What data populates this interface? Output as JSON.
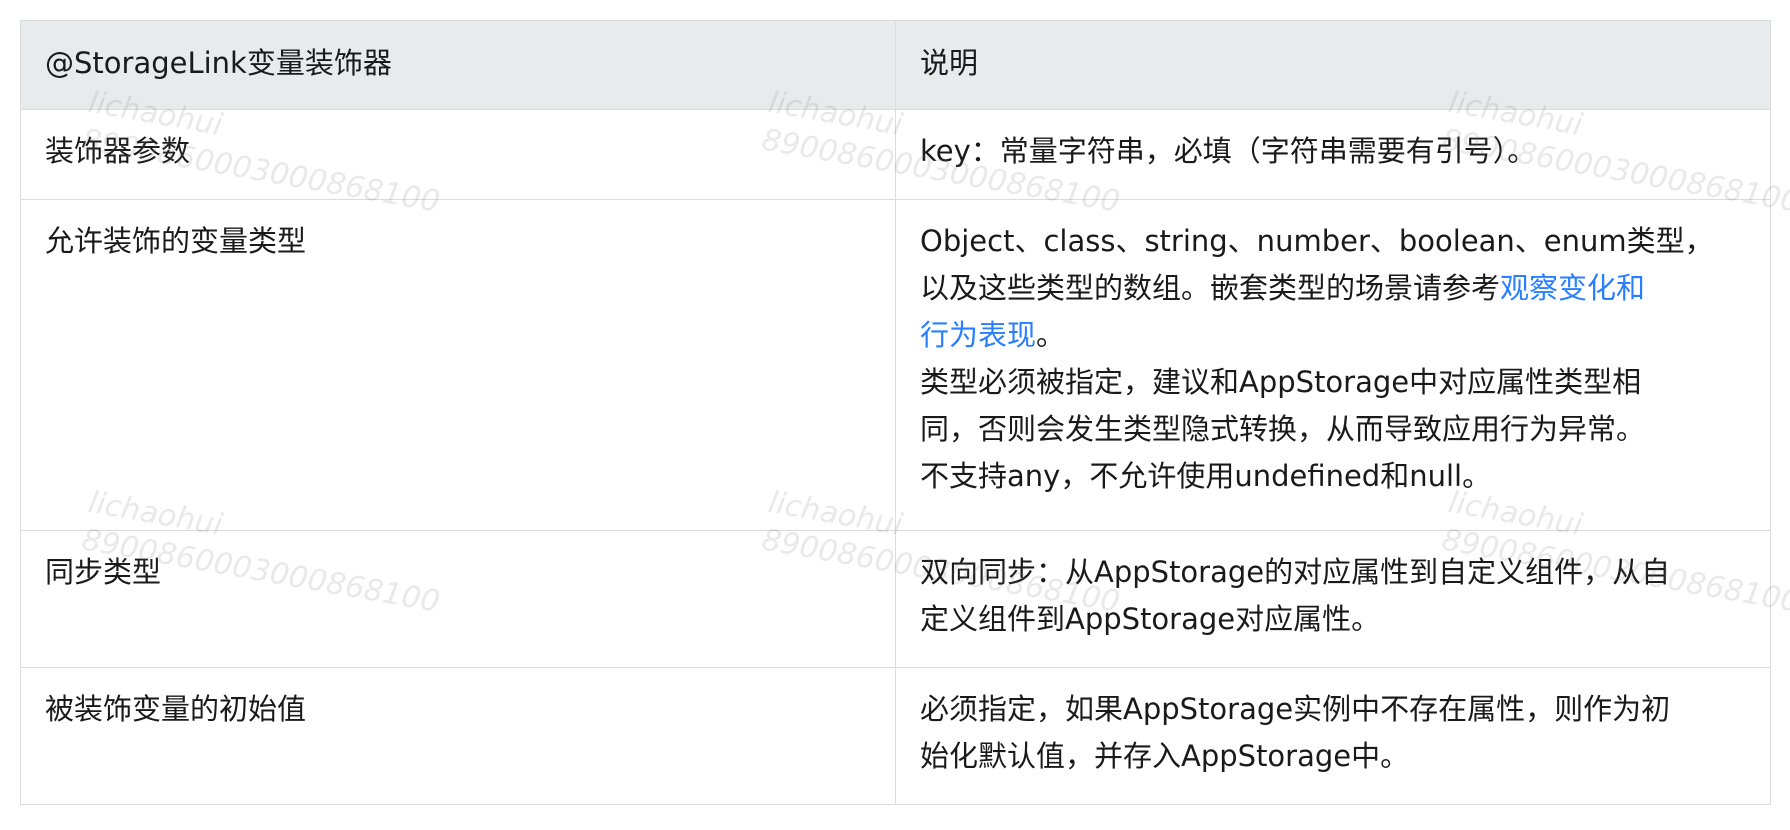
{
  "table": {
    "headers": [
      "@StorageLink变量装饰器",
      "说明"
    ],
    "rows": [
      {
        "label": "装饰器参数",
        "desc": "key：常量字符串，必填（字符串需要有引号）。"
      },
      {
        "label": "允许装饰的变量类型",
        "desc_line1": "Object、class、string、number、boolean、enum类型，",
        "desc_line2_prefix": "以及这些类型的数组。嵌套类型的场景请参考",
        "desc_link_part1": "观察变化和",
        "desc_link_part2": "行为表现",
        "desc_link_suffix": "。",
        "desc_line4": "类型必须被指定，建议和AppStorage中对应属性类型相",
        "desc_line5": "同，否则会发生类型隐式转换，从而导致应用行为异常。",
        "desc_line6": "不支持any，不允许使用undefined和null。"
      },
      {
        "label": "同步类型",
        "desc_line1": "双向同步：从AppStorage的对应属性到自定义组件，从自",
        "desc_line2": "定义组件到AppStorage对应属性。"
      },
      {
        "label": "被装饰变量的初始值",
        "desc_line1": "必须指定，如果AppStorage实例中不存在属性，则作为初",
        "desc_line2": "始化默认值，并存入AppStorage中。"
      }
    ]
  },
  "watermark": {
    "name": "lichaohui",
    "id": "8900860003000868100"
  },
  "colors": {
    "header_bg": "#e9eaec",
    "border": "#dcdcdc",
    "link": "#2a7fff",
    "text": "#1a1a1a"
  }
}
